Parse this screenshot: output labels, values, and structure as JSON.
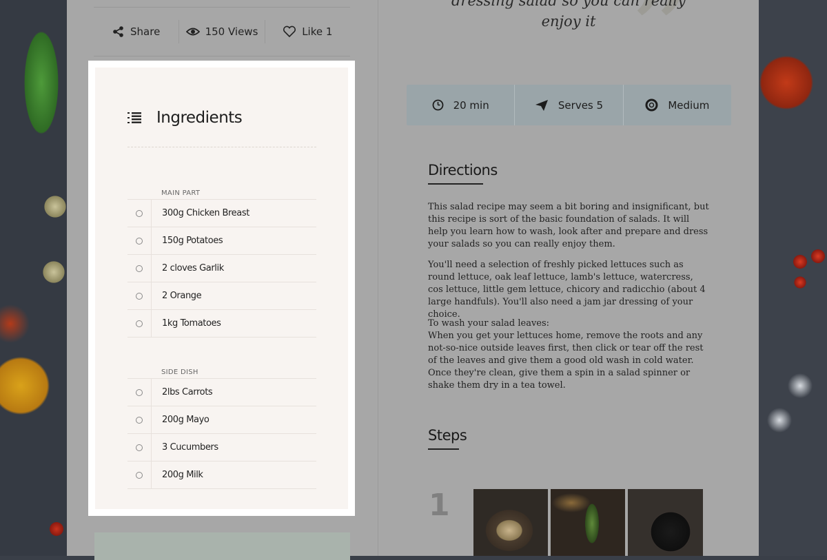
{
  "meta": {
    "share_label": "Share",
    "views_label": "150 Views",
    "like_label": "Like 1"
  },
  "ingredients": {
    "title": "Ingredients",
    "sections": [
      {
        "label": "MAIN PART",
        "items": [
          "300g Chicken Breast",
          "150g Potatoes",
          "2 cloves Garlik",
          "2 Orange",
          "1kg Tomatoes"
        ]
      },
      {
        "label": "SIDE DISH",
        "items": [
          "2lbs Carrots",
          "200g Mayo",
          "3 Cucumbers",
          "200g Milk"
        ]
      }
    ]
  },
  "quote": {
    "line1": "dressing salad so you can really",
    "line2": "enjoy it"
  },
  "info": {
    "time": "20 min",
    "serves": "Serves 5",
    "difficulty": "Medium"
  },
  "directions": {
    "title": "Directions",
    "paragraphs": [
      "This salad recipe may seem a bit boring and insignificant, but this recipe is sort of the basic foundation of salads. It will help you learn how to wash, look after and prepare and dress your salads so you can really enjoy them.",
      "You'll need a selection of freshly picked lettuces such as round lettuce, oak leaf lettuce, lamb's lettuce, watercress, cos lettuce, little gem lettuce, chicory and radicchio (about 4 large handfuls). You'll also need a jam jar dressing of your choice.",
      "To wash your salad leaves:",
      "When you get your lettuces home, remove the roots and any not-so-nice outside leaves first, then click or tear off the rest of the leaves and give them a good old wash in cold water. Once they're clean, give them a spin in a salad spinner or shake them dry in a tea towel."
    ]
  },
  "steps": {
    "title": "Steps",
    "first_number": "1"
  }
}
